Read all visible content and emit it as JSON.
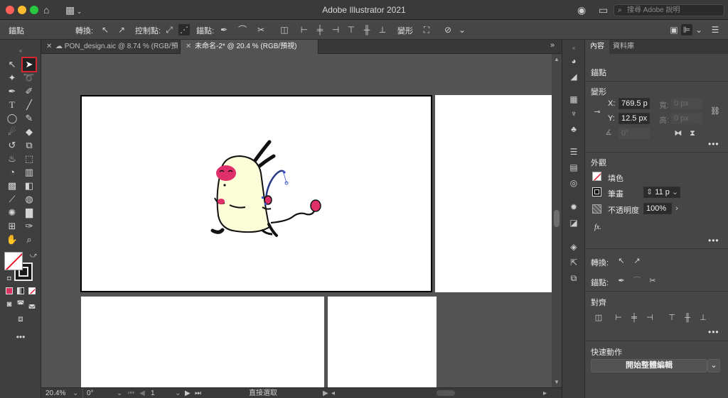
{
  "app": {
    "title": "Adobe Illustrator 2021",
    "search_placeholder": "搜尋 Adobe 說明"
  },
  "control_bar": {
    "anchor_label": "錨點",
    "convert_label": "轉換:",
    "handles_label": "控制點:",
    "anchors_label": "錨點:",
    "transform_label": "變形"
  },
  "tabs": [
    {
      "label": "PON_design.aic @ 8.74 % (RGB/預視)",
      "active": false
    },
    {
      "label": "未命名-2* @ 20.4 % (RGB/預視)",
      "active": true
    }
  ],
  "status_bar": {
    "zoom": "20.4%",
    "rotation": "0°",
    "artboard": "1",
    "tool_name": "直接選取"
  },
  "panel": {
    "tabs": [
      "內容",
      "資料庫"
    ],
    "selection_title": "錨點",
    "transform": {
      "title": "變形",
      "x_label": "X:",
      "x_value": "769.5 p",
      "y_label": "Y:",
      "y_value": "12.5 px",
      "w_label": "寬:",
      "w_value": "0 px",
      "h_label": "高:",
      "h_value": "0 px",
      "angle_value": "0°"
    },
    "appearance": {
      "title": "外觀",
      "fill_label": "填色",
      "stroke_label": "筆畫",
      "stroke_value": "11 p",
      "opacity_label": "不透明度",
      "opacity_value": "100%",
      "fx_label": "fx."
    },
    "convert_label": "轉換:",
    "anchors_label": "錨點:",
    "align_title": "對齊",
    "quick_actions": {
      "title": "快速動作",
      "button_label": "開始整體編輯"
    }
  },
  "colors": {
    "character_body": "#fbfdd8",
    "character_pink": "#e0306a",
    "outline": "#111111",
    "selected_path": "#2a3a86",
    "anchor": "#3b56c7",
    "selected_tool_outline": "#d4282e"
  },
  "icons": {
    "toolbar": [
      "selection-tool-icon",
      "direct-selection-tool-icon",
      "magic-wand-icon",
      "lasso-icon",
      "pen-tool-icon",
      "curvature-icon",
      "type-tool-icon",
      "line-tool-icon",
      "ellipse-tool-icon",
      "paintbrush-icon",
      "shaper-icon",
      "eraser-icon",
      "rotate-icon",
      "scale-icon",
      "warp-icon",
      "free-transform-icon",
      "shape-builder-icon",
      "perspective-icon",
      "mesh-icon",
      "gradient-icon",
      "eyedropper-icon",
      "blend-icon",
      "symbol-sprayer-icon",
      "graph-icon",
      "artboard-icon",
      "slice-icon",
      "hand-icon",
      "zoom-icon"
    ]
  }
}
